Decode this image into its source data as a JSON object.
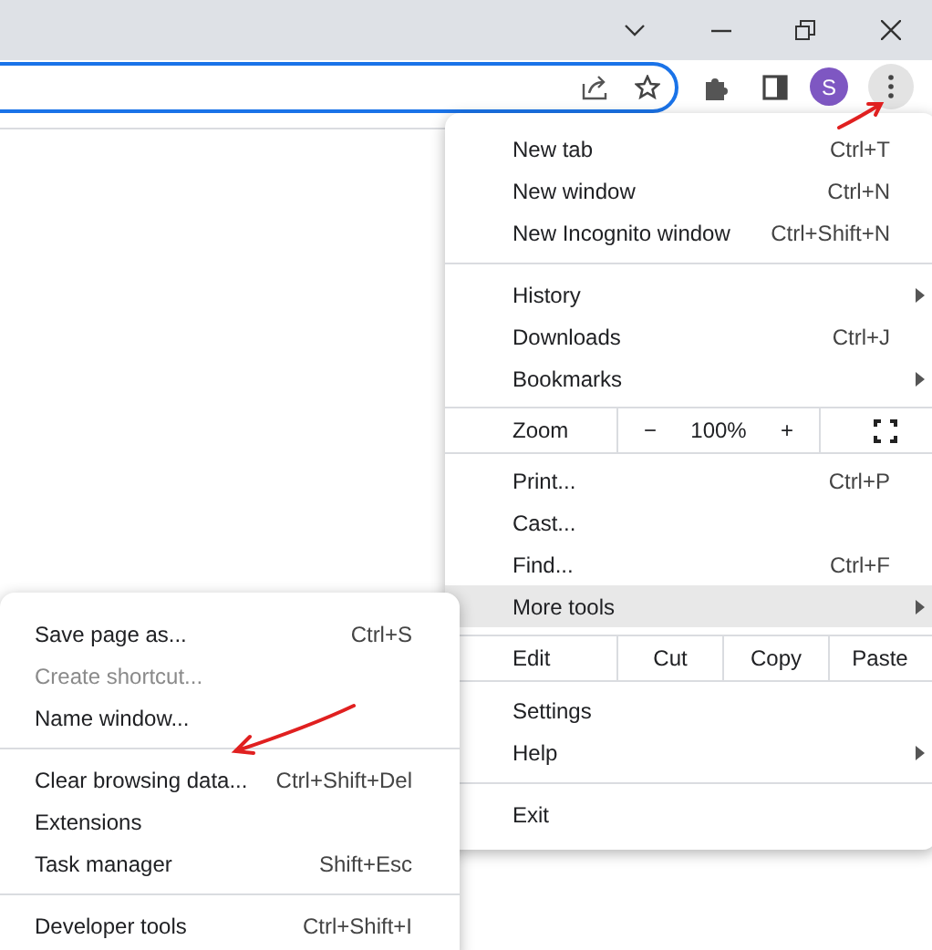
{
  "toolbar": {
    "avatar": "S"
  },
  "menu": {
    "items": [
      {
        "kind": "item",
        "label": "New tab",
        "shortcut": "Ctrl+T",
        "submenu": false,
        "highlighted": false
      },
      {
        "kind": "item",
        "label": "New window",
        "shortcut": "Ctrl+N",
        "submenu": false,
        "highlighted": false
      },
      {
        "kind": "item",
        "label": "New Incognito window",
        "shortcut": "Ctrl+Shift+N",
        "submenu": false,
        "highlighted": false
      },
      {
        "kind": "separator"
      },
      {
        "kind": "item",
        "label": "History",
        "submenu": true,
        "highlighted": false
      },
      {
        "kind": "item",
        "label": "Downloads",
        "shortcut": "Ctrl+J",
        "submenu": false,
        "highlighted": false
      },
      {
        "kind": "item",
        "label": "Bookmarks",
        "submenu": true,
        "highlighted": false
      },
      {
        "kind": "zoom",
        "label": "Zoom",
        "minus": "−",
        "value": "100%",
        "plus": "+"
      },
      {
        "kind": "item",
        "label": "Print...",
        "shortcut": "Ctrl+P",
        "submenu": false,
        "highlighted": false
      },
      {
        "kind": "item",
        "label": "Cast...",
        "submenu": false,
        "highlighted": false
      },
      {
        "kind": "item",
        "label": "Find...",
        "shortcut": "Ctrl+F",
        "submenu": false,
        "highlighted": false
      },
      {
        "kind": "item",
        "label": "More tools",
        "submenu": true,
        "highlighted": true
      },
      {
        "kind": "edit",
        "label": "Edit",
        "actions": [
          "Cut",
          "Copy",
          "Paste"
        ]
      },
      {
        "kind": "item",
        "label": "Settings",
        "submenu": false,
        "highlighted": false
      },
      {
        "kind": "item",
        "label": "Help",
        "submenu": true,
        "highlighted": false
      },
      {
        "kind": "separator"
      },
      {
        "kind": "item",
        "label": "Exit",
        "submenu": false,
        "highlighted": false
      }
    ]
  },
  "submenu": {
    "items": [
      {
        "kind": "item",
        "label": "Save page as...",
        "shortcut": "Ctrl+S",
        "disabled": false
      },
      {
        "kind": "item",
        "label": "Create shortcut...",
        "disabled": true
      },
      {
        "kind": "item",
        "label": "Name window...",
        "disabled": false
      },
      {
        "kind": "separator"
      },
      {
        "kind": "item",
        "label": "Clear browsing data...",
        "shortcut": "Ctrl+Shift+Del",
        "disabled": false
      },
      {
        "kind": "item",
        "label": "Extensions",
        "disabled": false
      },
      {
        "kind": "item",
        "label": "Task manager",
        "shortcut": "Shift+Esc",
        "disabled": false
      },
      {
        "kind": "separator"
      },
      {
        "kind": "item",
        "label": "Developer tools",
        "shortcut": "Ctrl+Shift+I",
        "disabled": false
      }
    ]
  }
}
